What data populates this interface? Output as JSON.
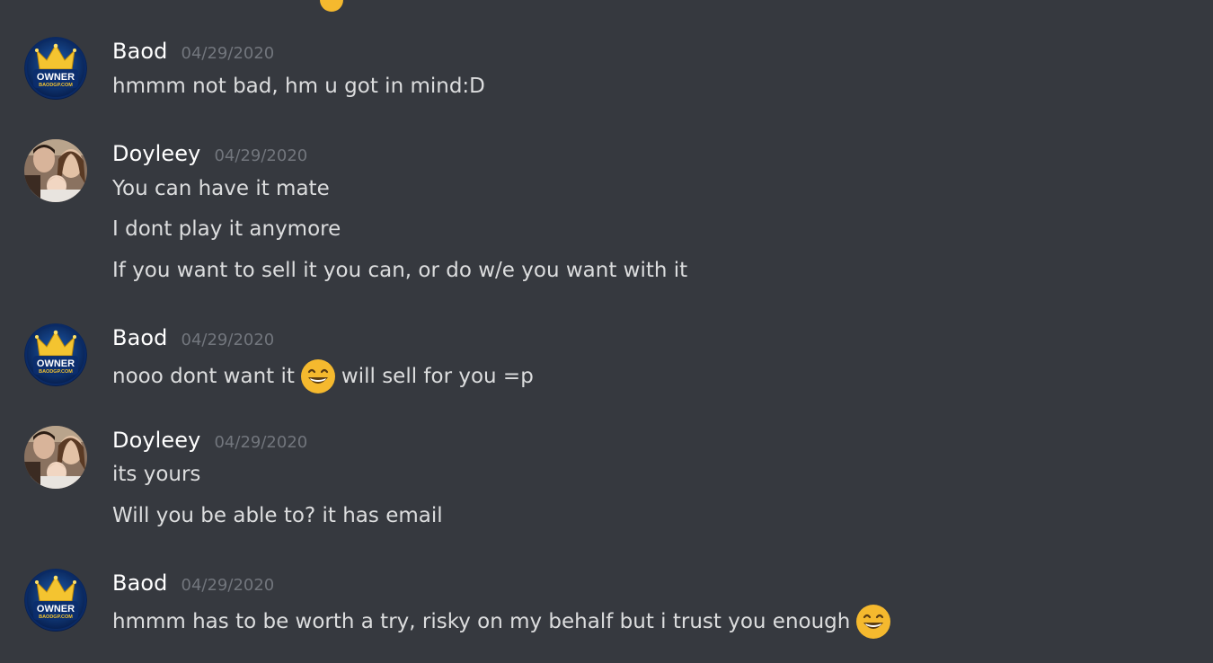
{
  "messages": [
    {
      "author": "Baod",
      "avatar": "owner-crown-avatar",
      "avatar_text": [
        "OWNER",
        "BAODGP.COM"
      ],
      "timestamp": "04/29/2020",
      "lines": [
        {
          "parts": [
            "hmmm not bad, hm u got in mind:D"
          ]
        }
      ]
    },
    {
      "author": "Doyleey",
      "avatar": "family-photo-avatar",
      "timestamp": "04/29/2020",
      "lines": [
        {
          "parts": [
            "You can have it mate"
          ]
        },
        {
          "parts": [
            "I dont play it anymore"
          ]
        },
        {
          "parts": [
            "If you want to sell it you can, or do w/e you want with it"
          ]
        }
      ]
    },
    {
      "author": "Baod",
      "avatar": "owner-crown-avatar",
      "avatar_text": [
        "OWNER",
        "BAODGP.COM"
      ],
      "timestamp": "04/29/2020",
      "lines": [
        {
          "parts": [
            "nooo dont want it",
            "grinning-emoji",
            "will sell for you =p"
          ]
        }
      ]
    },
    {
      "author": "Doyleey",
      "avatar": "family-photo-avatar",
      "timestamp": "04/29/2020",
      "lines": [
        {
          "parts": [
            "its yours"
          ]
        },
        {
          "parts": [
            "Will you be able to? it has email"
          ]
        }
      ]
    },
    {
      "author": "Baod",
      "avatar": "owner-crown-avatar",
      "avatar_text": [
        "OWNER",
        "BAODGP.COM"
      ],
      "timestamp": "04/29/2020",
      "lines": [
        {
          "parts": [
            "hmmm has to be worth a try, risky on my behalf but i trust you enough",
            "grinning-emoji"
          ]
        }
      ]
    }
  ],
  "colors": {
    "background": "#36393f",
    "username": "#ffffff",
    "timestamp": "#72767d",
    "message_text": "#dcddde",
    "emoji": "#f5b92e"
  }
}
